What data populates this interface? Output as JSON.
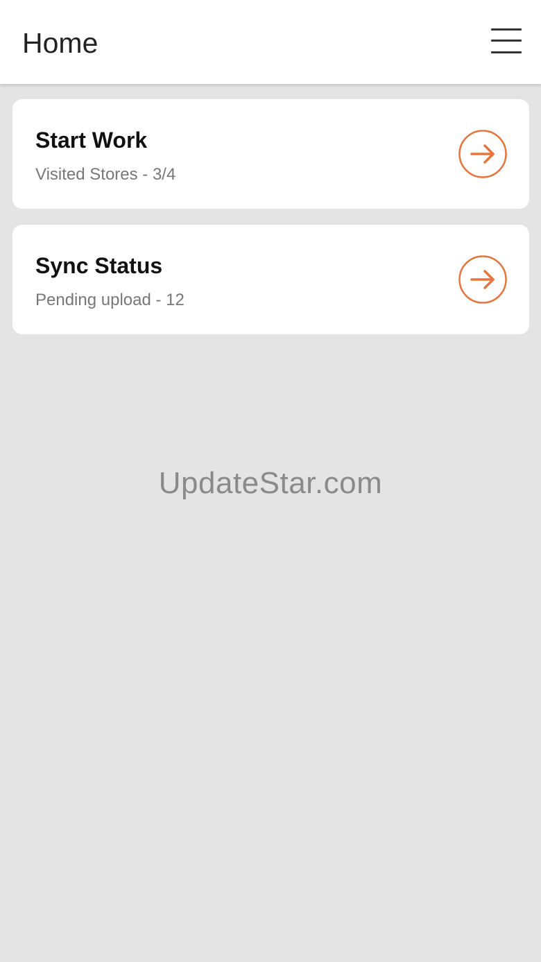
{
  "app_bar": {
    "title": "Home",
    "menu_icon": "hamburger-menu-icon"
  },
  "cards": [
    {
      "title": "Start Work",
      "subtitle": "Visited Stores - 3/4",
      "icon": "arrow-right-circle-icon"
    },
    {
      "title": "Sync Status",
      "subtitle": "Pending upload - 12",
      "icon": "arrow-right-circle-icon"
    }
  ],
  "watermark": "UpdateStar.com",
  "colors": {
    "accent": "#e8743b",
    "background": "#e4e4e4",
    "surface": "#ffffff"
  }
}
